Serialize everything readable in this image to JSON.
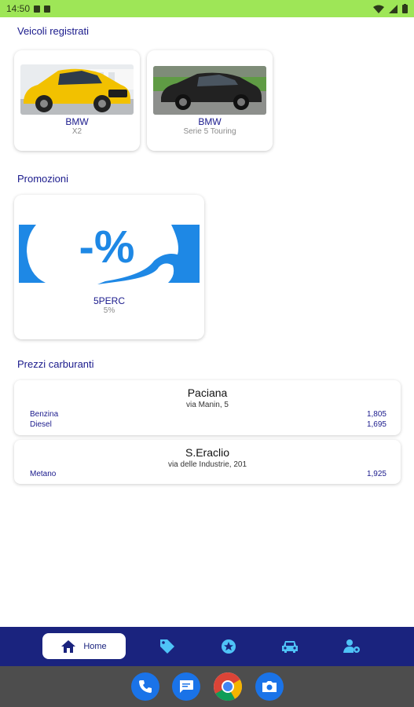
{
  "status_bar": {
    "time": "14:50"
  },
  "sections": {
    "vehicles_title": "Veicoli registrati",
    "promotions_title": "Promozioni",
    "fuel_title": "Prezzi carburanti"
  },
  "vehicles": [
    {
      "brand": "BMW",
      "model": "X2",
      "color": "#f2c100"
    },
    {
      "brand": "BMW",
      "model": "Serie 5 Touring",
      "color": "#222222"
    }
  ],
  "promotions": [
    {
      "code": "5PERC",
      "value": "5%",
      "graphic_text": "-%",
      "color": "#1e88e5"
    }
  ],
  "stations": [
    {
      "name": "Paciana",
      "address": "via Manin, 5",
      "fuels": [
        {
          "type": "Benzina",
          "price": "1,805"
        },
        {
          "type": "Diesel",
          "price": "1,695"
        }
      ]
    },
    {
      "name": "S.Eraclio",
      "address": "via delle Industrie, 201",
      "fuels": [
        {
          "type": "Metano",
          "price": "1,925"
        }
      ]
    }
  ],
  "bottom_nav": {
    "home_label": "Home",
    "items": [
      "home-icon",
      "tag-icon",
      "star-badge-icon",
      "car-icon",
      "user-settings-icon"
    ],
    "accent": "#4fc3f7",
    "background": "#1a237e"
  },
  "dock": {
    "apps": [
      "phone-icon",
      "messages-icon",
      "chrome-icon",
      "camera-icon"
    ]
  }
}
